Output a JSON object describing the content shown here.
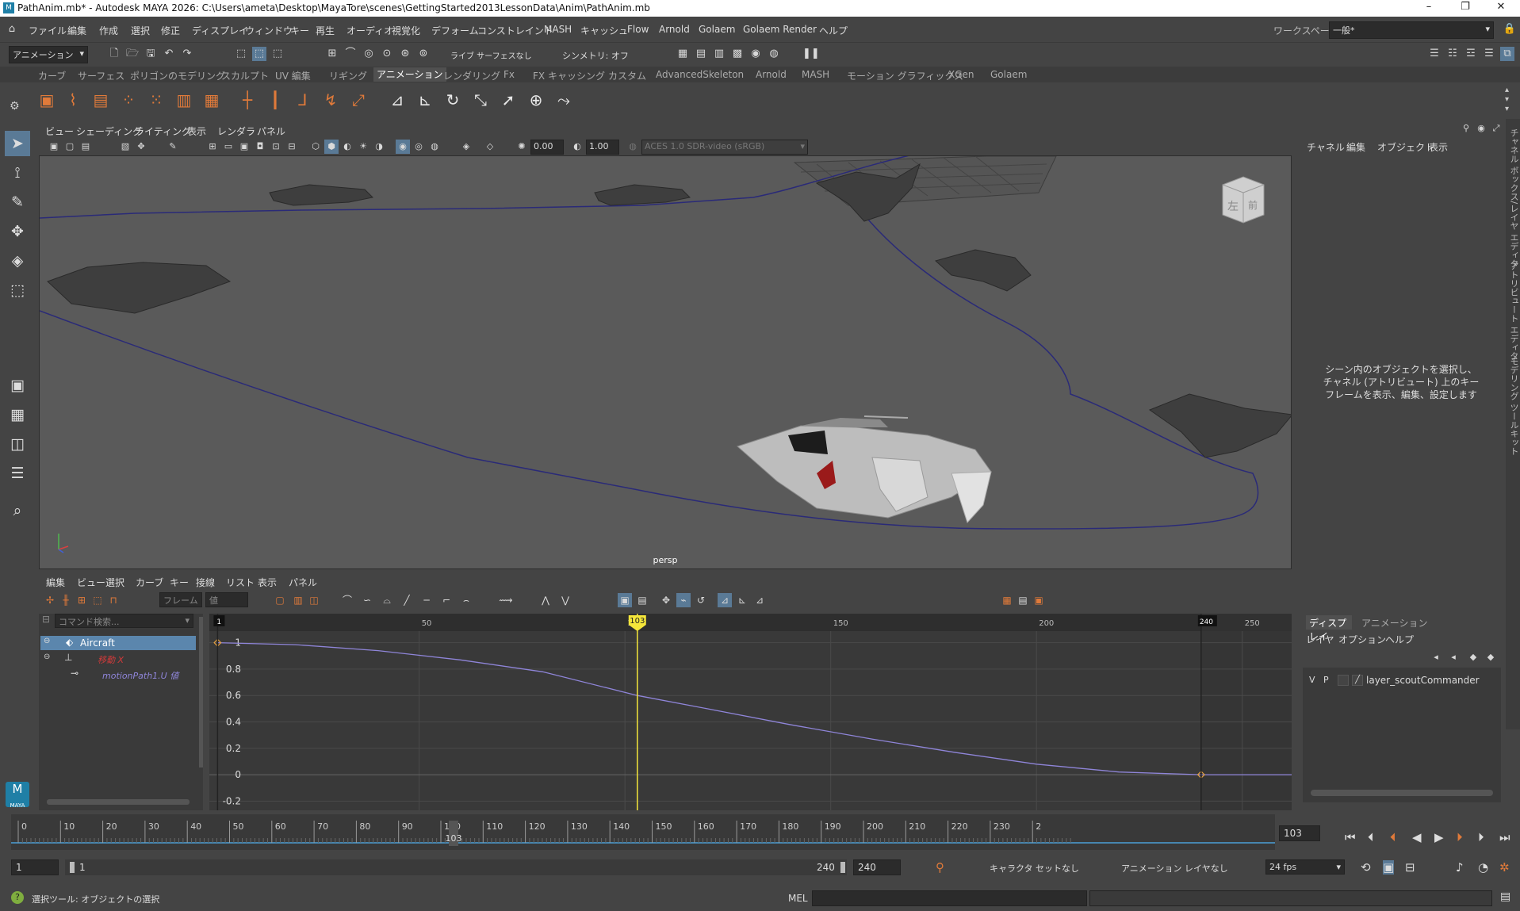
{
  "window": {
    "title": "PathAnim.mb* - Autodesk MAYA 2026: C:\\Users\\ameta\\Desktop\\MayaTore\\scenes\\GettingStarted2013LessonData\\Anim\\PathAnim.mb"
  },
  "menu": [
    "ファイル",
    "編集",
    "作成",
    "選択",
    "修正",
    "ディスプレイ",
    "ウィンドウ",
    "キー",
    "再生",
    "オーディオ",
    "視覚化",
    "デフォーム",
    "コンストレイント",
    "MASH",
    "キャッシュ",
    "Flow",
    "Arnold",
    "Golaem",
    "Golaem Render",
    "ヘルプ"
  ],
  "workspace": {
    "label": "ワークスペース :",
    "value": "一般*"
  },
  "statusline": {
    "menuset": "アニメーション",
    "live_surface": "ライブ サーフェスなし",
    "symmetry": "シンメトリ: オフ"
  },
  "shelf_tabs": [
    "カーブ",
    "サーフェス",
    "ポリゴンのモデリング",
    "スカルプト",
    "UV 編集",
    "リギング",
    "アニメーション",
    "レンダリング",
    "Fx",
    "FX キャッシング",
    "カスタム",
    "AdvancedSkeleton",
    "Arnold",
    "MASH",
    "モーション グラフィックス",
    "XGen",
    "Golaem"
  ],
  "active_shelf_tab": "アニメーション",
  "viewport": {
    "menu": [
      "ビュー",
      "シェーディング",
      "ライティング",
      "表示",
      "レンダラ",
      "パネル"
    ],
    "field_a": "0.00",
    "field_b": "1.00",
    "colorspace": "ACES 1.0 SDR-video (sRGB)",
    "camera": "persp",
    "viewcube_left": "左",
    "viewcube_front": "前"
  },
  "channel_box": {
    "tabs": [
      "チャネル",
      "編集",
      "オブジェクト",
      "表示"
    ],
    "message": "シーン内のオブジェクトを選択し、チャネル (アトリビュート) 上のキーフレームを表示、編集、設定します"
  },
  "right_strip": [
    "チャネル ボックス/レイヤ エディタ",
    "アトリビュート エディタ",
    "モデリング ツールキット"
  ],
  "layer_editor": {
    "tabs": [
      "ディスプレイ",
      "アニメーション"
    ],
    "menu": [
      "レイヤ",
      "オプション",
      "ヘルプ"
    ],
    "layer": {
      "v": "V",
      "p": "P",
      "name": "layer_scoutCommander"
    }
  },
  "graph_editor": {
    "menu": [
      "編集",
      "ビュー",
      "選択",
      "カーブ",
      "キー",
      "接線",
      "リスト",
      "表示",
      "パネル"
    ],
    "frame_label": "フレーム",
    "value_label": "値",
    "search_placeholder": "コマンド検索...",
    "outliner": [
      {
        "name": "Aircraft",
        "kind": "object"
      },
      {
        "name": "移動 X",
        "kind": "attr"
      },
      {
        "name": "motionPath1.U 値",
        "kind": "curve"
      }
    ],
    "current_frame": "103",
    "end_marker": "240",
    "start_marker": "1",
    "x_ticks": [
      1,
      50,
      100,
      150,
      200,
      250
    ],
    "y_ticks": [
      "1",
      "0.8",
      "0.6",
      "0.4",
      "0.2",
      "0",
      "-0.2"
    ]
  },
  "chart_data": {
    "type": "line",
    "title": "",
    "xlabel": "",
    "ylabel": "",
    "xlim": [
      -1,
      262
    ],
    "ylim": [
      -0.27,
      1.07
    ],
    "series": [
      {
        "name": "motionPath1.U 値",
        "x": [
          1,
          20,
          40,
          60,
          80,
          103,
          120,
          140,
          160,
          180,
          200,
          220,
          240,
          262
        ],
        "y": [
          1.0,
          0.985,
          0.94,
          0.87,
          0.78,
          0.6,
          0.5,
          0.38,
          0.27,
          0.17,
          0.08,
          0.02,
          0.0,
          0.0
        ]
      }
    ],
    "keys": [
      {
        "x": 1,
        "y": 1.0
      },
      {
        "x": 240,
        "y": 0.0
      }
    ]
  },
  "time_slider": {
    "ticks": [
      0,
      10,
      20,
      30,
      40,
      50,
      60,
      70,
      80,
      90,
      100,
      110,
      120,
      130,
      140,
      150,
      160,
      170,
      180,
      190,
      200,
      210,
      220,
      230,
      "2"
    ],
    "current": "103",
    "current_field": "103"
  },
  "range": {
    "start": "1",
    "inner_start": "1",
    "inner_end": "240",
    "end": "240",
    "character_set": "キャラクタ セットなし",
    "anim_layer": "アニメーション レイヤなし",
    "fps": "24 fps"
  },
  "help_line": "選択ツール: オブジェクトの選択",
  "command_line": {
    "label": "MEL"
  },
  "maya_logo": "MAYA",
  "colors": {
    "curve": "#8f85d9",
    "current_time": "#f5e63a",
    "path": "#2a2a78",
    "key": "#e5a040"
  }
}
